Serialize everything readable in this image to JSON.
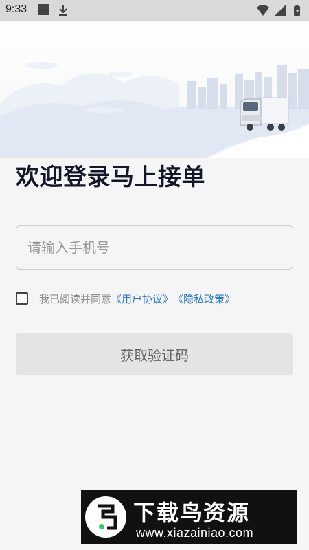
{
  "status_bar": {
    "time": "9:33",
    "icons": [
      "notification-square-icon",
      "download-icon",
      "wifi-icon",
      "signal-icon",
      "battery-icon"
    ]
  },
  "login": {
    "title": "欢迎登录马上接单",
    "phone_placeholder": "请输入手机号",
    "phone_value": "",
    "agreement_prefix": "我已阅读并同意",
    "user_agreement_link": "《用户协议》",
    "privacy_policy_link": "《隐私政策》",
    "agreement_checked": false,
    "get_code_button": "获取验证码"
  },
  "watermark": {
    "title": "下载鸟资源",
    "url": "www.xiazainiao.com"
  }
}
